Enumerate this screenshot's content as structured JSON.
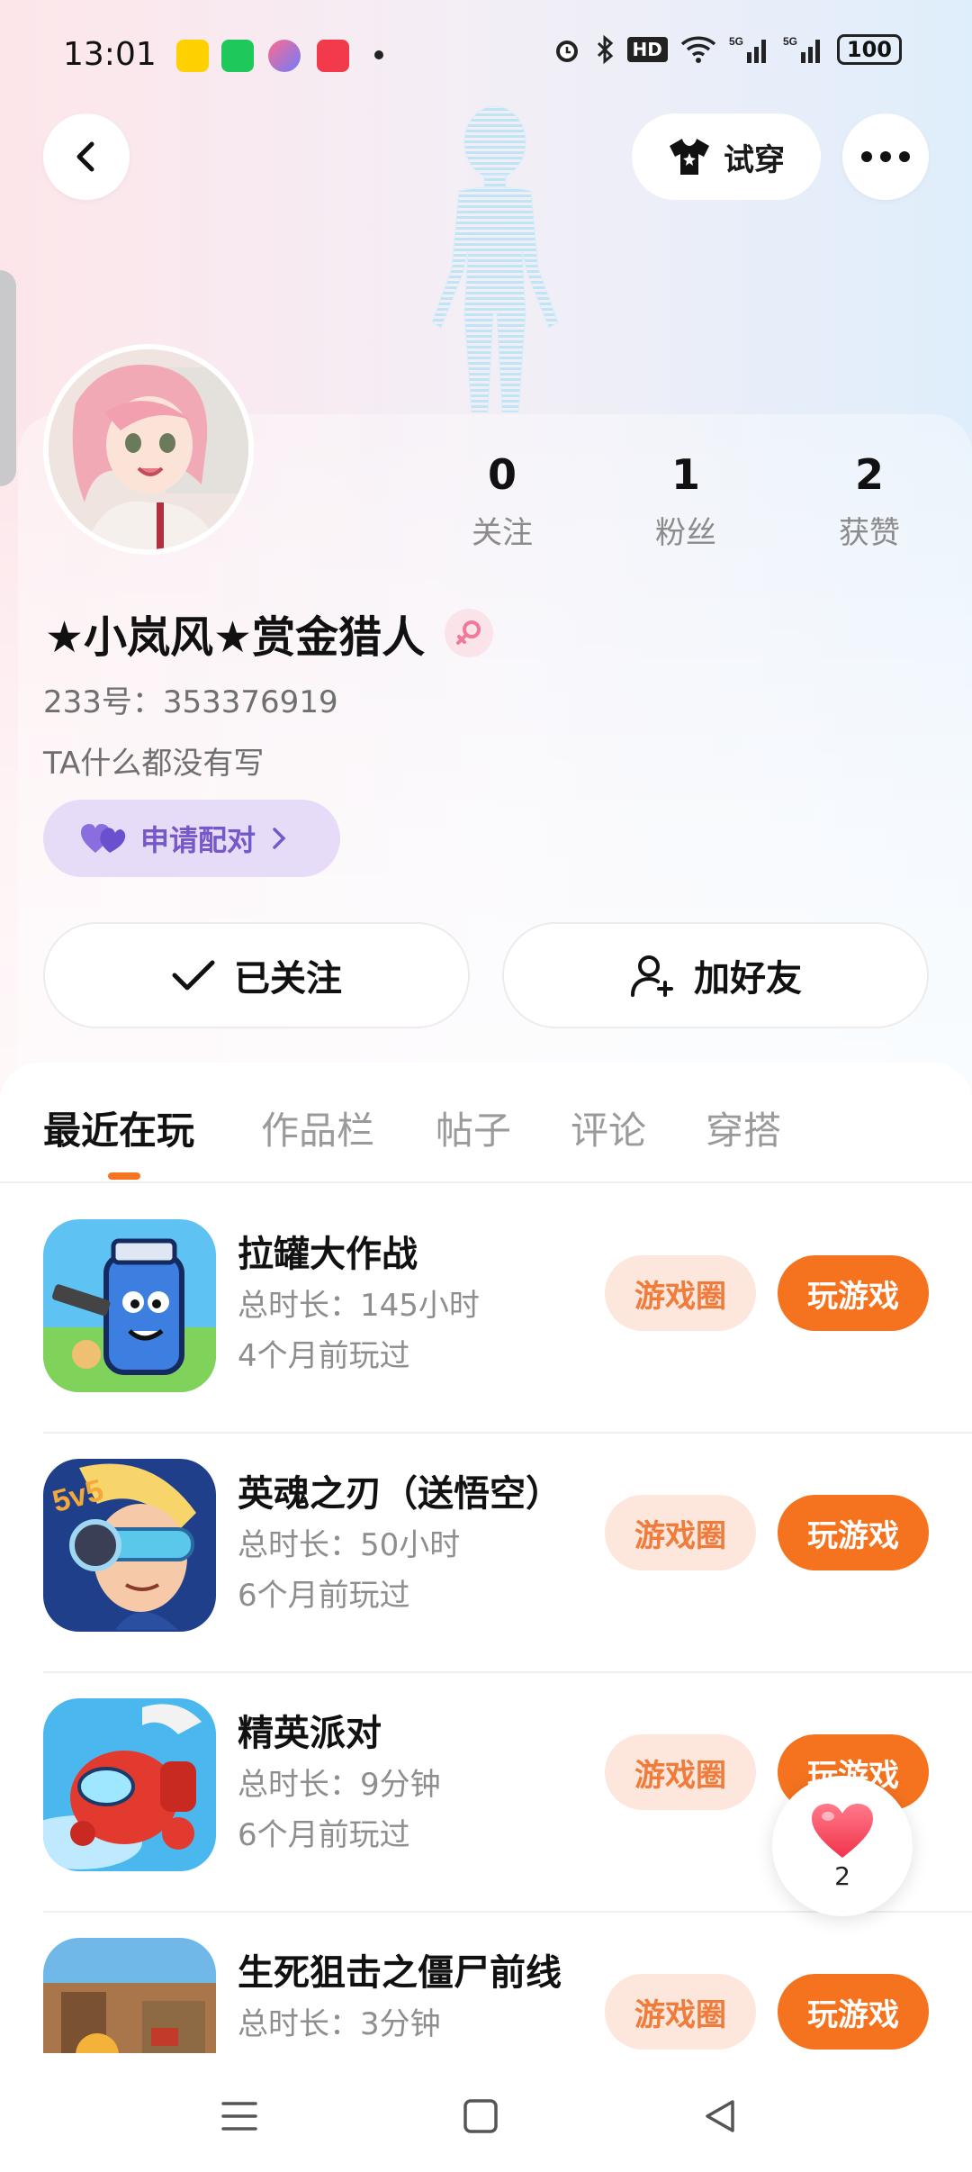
{
  "status_bar": {
    "time": "13:01",
    "app_icons": [
      "meituan-icon",
      "wechat-icon",
      "app-icon",
      "music-icon"
    ],
    "right_icons": [
      "alarm-icon",
      "bluetooth-icon",
      "hd-icon",
      "wifi-icon",
      "5g-signal-icon",
      "5g-signal-icon"
    ],
    "hd_label": "HD",
    "battery": "100"
  },
  "header": {
    "try_on_label": "试穿"
  },
  "profile": {
    "stats": [
      {
        "value": "0",
        "label": "关注"
      },
      {
        "value": "1",
        "label": "粉丝"
      },
      {
        "value": "2",
        "label": "获赞"
      }
    ],
    "name": "★小岚风★赏金猎人",
    "id_line": "233号：353376919",
    "bio": "TA什么都没有写",
    "pair_label": "申请配对",
    "followed_label": "已关注",
    "add_friend_label": "加好友"
  },
  "tabs": [
    {
      "label": "最近在玩",
      "active": true
    },
    {
      "label": "作品栏",
      "active": false
    },
    {
      "label": "帖子",
      "active": false
    },
    {
      "label": "评论",
      "active": false
    },
    {
      "label": "穿搭",
      "active": false
    }
  ],
  "games": [
    {
      "title": "拉罐大作战",
      "duration": "总时长：145小时",
      "last_played": "4个月前玩过",
      "circle_label": "游戏圈",
      "play_label": "玩游戏"
    },
    {
      "title": "英魂之刃（送悟空）",
      "duration": "总时长：50小时",
      "last_played": "6个月前玩过",
      "circle_label": "游戏圈",
      "play_label": "玩游戏",
      "icon_badge": "5v5"
    },
    {
      "title": "精英派对",
      "duration": "总时长：9分钟",
      "last_played": "6个月前玩过",
      "circle_label": "游戏圈",
      "play_label": "玩游戏"
    },
    {
      "title": "生死狙击之僵尸前线",
      "duration": "总时长：3分钟",
      "last_played": "",
      "circle_label": "游戏圈",
      "play_label": "玩游戏"
    }
  ],
  "like_fab": {
    "count": "2"
  },
  "colors": {
    "accent_orange": "#f5731f",
    "circle_pill_bg": "#fde6dc",
    "pair_bg": "#e6dcf7",
    "pair_text": "#7658c9"
  }
}
